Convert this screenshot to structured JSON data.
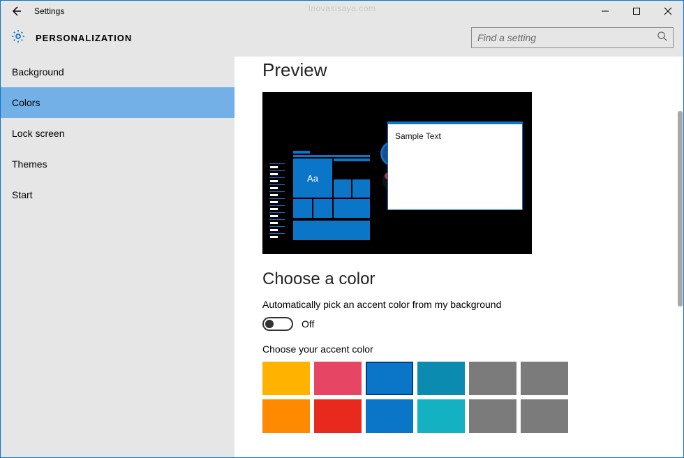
{
  "watermark": "Inovasisaya.com",
  "window": {
    "title": "Settings"
  },
  "header": {
    "section": "PERSONALIZATION",
    "search_placeholder": "Find a setting"
  },
  "sidebar": {
    "items": [
      {
        "label": "Background",
        "selected": false
      },
      {
        "label": "Colors",
        "selected": true
      },
      {
        "label": "Lock screen",
        "selected": false
      },
      {
        "label": "Themes",
        "selected": false
      },
      {
        "label": "Start",
        "selected": false
      }
    ]
  },
  "main": {
    "preview_heading": "Preview",
    "preview_tile_text": "Aa",
    "preview_sample_text": "Sample Text",
    "choose_heading": "Choose a color",
    "auto_pick_label": "Automatically pick an accent color from my background",
    "toggle_state_label": "Off",
    "accent_label": "Choose your accent color",
    "swatches_row1": [
      {
        "hex": "#ffb200",
        "selected": false
      },
      {
        "hex": "#e64664",
        "selected": false
      },
      {
        "hex": "#0b75c8",
        "selected": true
      },
      {
        "hex": "#0b8bb0",
        "selected": false
      },
      {
        "hex": "#7b7b7b",
        "selected": false
      },
      {
        "hex": "#7b7b7b",
        "selected": false
      }
    ],
    "swatches_row2": [
      {
        "hex": "#ff8a00"
      },
      {
        "hex": "#e82a1e"
      },
      {
        "hex": "#0b75c8"
      },
      {
        "hex": "#13b1c2"
      },
      {
        "hex": "#7b7b7b"
      },
      {
        "hex": "#7b7b7b"
      }
    ]
  }
}
